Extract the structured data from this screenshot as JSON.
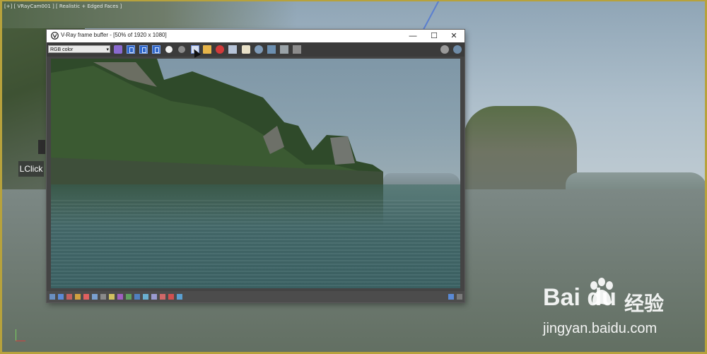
{
  "viewport": {
    "label": "[+] [ VRayCam001 ] [ Realistic + Edged Faces ]",
    "tooltip": "LClick"
  },
  "window": {
    "title": "V-Ray frame buffer - [50% of 1920 x 1080]",
    "minimize": "—",
    "maximize": "☐",
    "close": "✕"
  },
  "toolbar": {
    "channel": "RGB color"
  },
  "watermark": {
    "brand": "Bai du",
    "chinese": "经验",
    "url": "jingyan.baidu.com"
  },
  "colors": {
    "toolbar_blue": "#2f66c9",
    "viewport_border": "#b7a23c"
  }
}
